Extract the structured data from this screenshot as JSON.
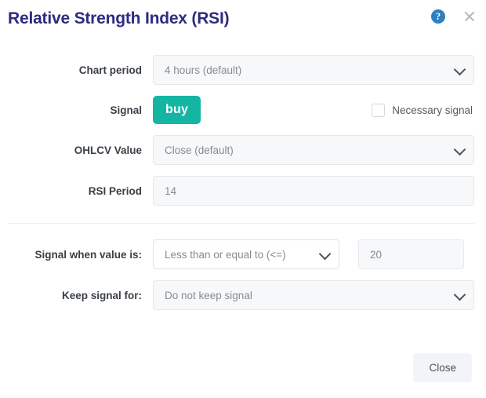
{
  "header": {
    "title": "Relative Strength Index (RSI)",
    "help_icon": "help-circle-icon",
    "help_glyph": "?",
    "close_icon": "close-icon"
  },
  "colors": {
    "title": "#2e2b7f",
    "signal_buy": "#15b5a3",
    "help_blue": "#2d7fc1",
    "field_bg": "#f7f8fa",
    "footer_button_bg": "#f3f4f9"
  },
  "form": {
    "chart_period": {
      "label": "Chart period",
      "value": "4 hours (default)",
      "type": "select"
    },
    "signal": {
      "label": "Signal",
      "button_label": "buy",
      "checkbox_label": "Necessary signal",
      "checkbox_checked": false
    },
    "ohlcv_value": {
      "label": "OHLCV Value",
      "value": "Close (default)",
      "type": "select"
    },
    "rsi_period": {
      "label": "RSI Period",
      "value": "14",
      "type": "text"
    },
    "signal_when": {
      "label": "Signal when value is:",
      "operator": "Less than or equal to (<=)",
      "threshold": "20"
    },
    "keep_signal": {
      "label": "Keep signal for:",
      "value": "Do not keep signal",
      "type": "select"
    }
  },
  "footer": {
    "close_label": "Close"
  }
}
